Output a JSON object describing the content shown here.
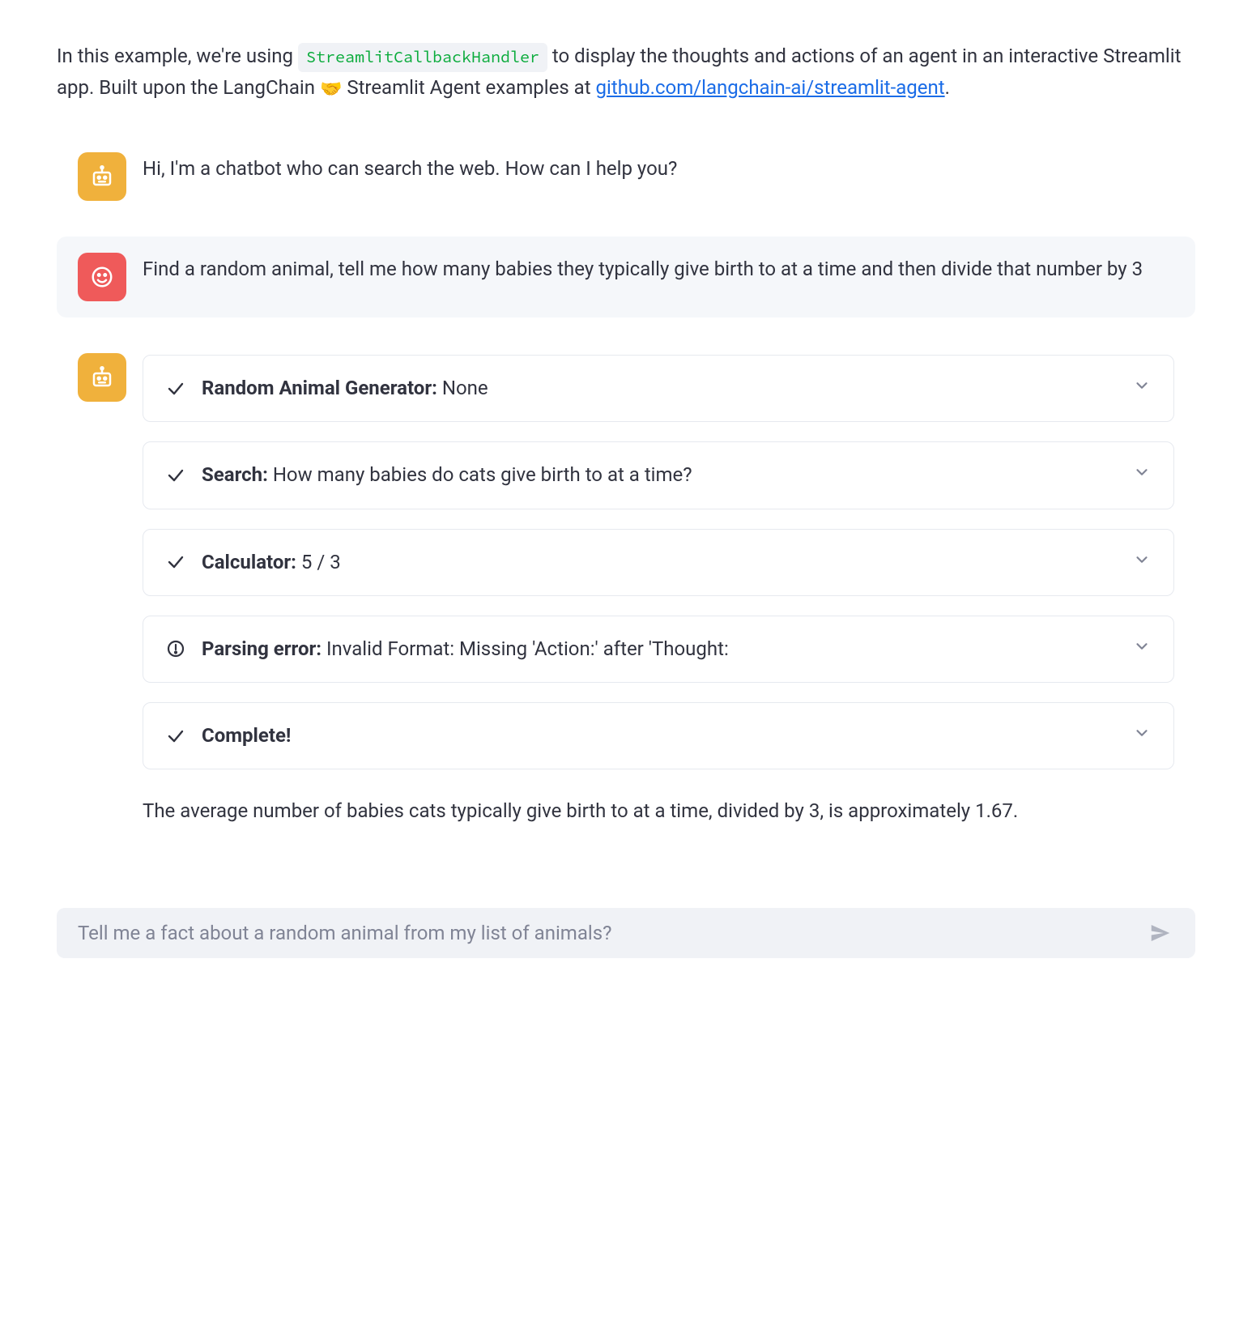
{
  "intro": {
    "text_prefix": "In this example, we're using ",
    "code_token": "StreamlitCallbackHandler",
    "text_mid1": " to display the thoughts and actions of an agent in an interactive Streamlit app. Built upon the LangChain ",
    "handshake": "🤝",
    "text_mid2": " Streamlit Agent examples at ",
    "link_text": "github.com/langchain-ai/streamlit-agent",
    "text_suffix": "."
  },
  "messages": {
    "assistant_greeting": "Hi, I'm a chatbot who can search the web. How can I help you?",
    "user_query": "Find a random animal, tell me how many babies they typically give birth to at a time and then divide that number by 3"
  },
  "steps": [
    {
      "icon": "check",
      "tool": "Random Animal Generator:",
      "detail": " None"
    },
    {
      "icon": "check",
      "tool": "Search:",
      "detail": " How many babies do cats give birth to at a time?"
    },
    {
      "icon": "check",
      "tool": "Calculator:",
      "detail": " 5 / 3"
    },
    {
      "icon": "error",
      "tool": "Parsing error:",
      "detail": " Invalid Format: Missing 'Action:' after 'Thought:"
    },
    {
      "icon": "check",
      "tool": "Complete!",
      "detail": ""
    }
  ],
  "final_answer": "The average number of babies cats typically give birth to at a time, divided by 3, is approximately 1.67.",
  "chat_input": {
    "placeholder": "Tell me a fact about a random animal from my list of animals?"
  }
}
